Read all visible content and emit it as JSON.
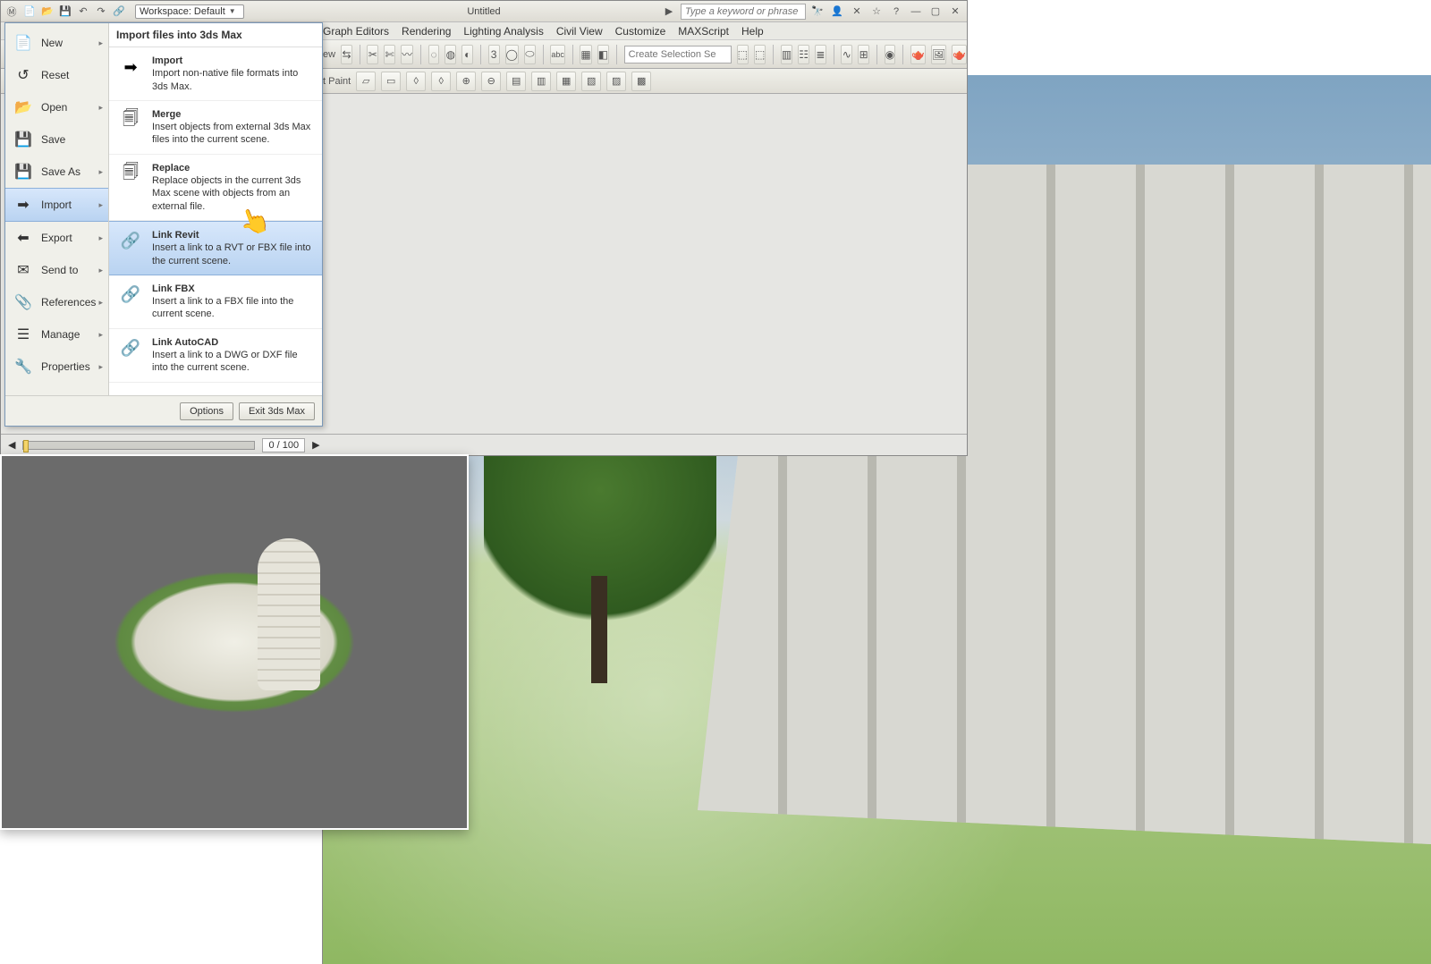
{
  "qat": {
    "workspace_label": "Workspace: Default",
    "title": "Untitled",
    "search_placeholder": "Type a keyword or phrase"
  },
  "menubar": [
    "Graph Editors",
    "Rendering",
    "Lighting Analysis",
    "Civil View",
    "Customize",
    "MAXScript",
    "Help"
  ],
  "toolbar": {
    "view_label": "ew",
    "three_label": "3",
    "selection_placeholder": "Create Selection Se"
  },
  "ribbon2": {
    "paint_label": "t Paint"
  },
  "appmenu": {
    "left": [
      {
        "label": "New",
        "icon": "📄",
        "chev": true
      },
      {
        "label": "Reset",
        "icon": "↺",
        "chev": false
      },
      {
        "label": "Open",
        "icon": "📂",
        "chev": true
      },
      {
        "label": "Save",
        "icon": "💾",
        "chev": false
      },
      {
        "label": "Save As",
        "icon": "💾",
        "chev": true
      },
      {
        "label": "Import",
        "icon": "➡",
        "chev": true,
        "selected": true
      },
      {
        "label": "Export",
        "icon": "⬅",
        "chev": true
      },
      {
        "label": "Send to",
        "icon": "✉",
        "chev": true
      },
      {
        "label": "References",
        "icon": "📎",
        "chev": true
      },
      {
        "label": "Manage",
        "icon": "☰",
        "chev": true
      },
      {
        "label": "Properties",
        "icon": "🔧",
        "chev": true
      }
    ],
    "right_header": "Import files into 3ds Max",
    "right": [
      {
        "title": "Import",
        "desc": "Import non-native file formats into 3ds Max.",
        "icon": "➡"
      },
      {
        "title": "Merge",
        "desc": "Insert objects from external 3ds Max files into the current scene.",
        "icon": "🗐"
      },
      {
        "title": "Replace",
        "desc": "Replace objects in the current 3ds Max scene with objects from an external file.",
        "icon": "🗐"
      },
      {
        "title": "Link Revit",
        "desc": "Insert a link to a RVT or FBX file into the current scene.",
        "icon": "🔗",
        "hl": true
      },
      {
        "title": "Link FBX",
        "desc": "Insert a link to a FBX file into the current scene.",
        "icon": "🔗"
      },
      {
        "title": "Link AutoCAD",
        "desc": "Insert a link to a DWG or DXF file into the current scene.",
        "icon": "🔗"
      }
    ],
    "footer": {
      "options": "Options",
      "exit": "Exit 3ds Max"
    }
  },
  "timeline": {
    "frames": "0 / 100"
  }
}
